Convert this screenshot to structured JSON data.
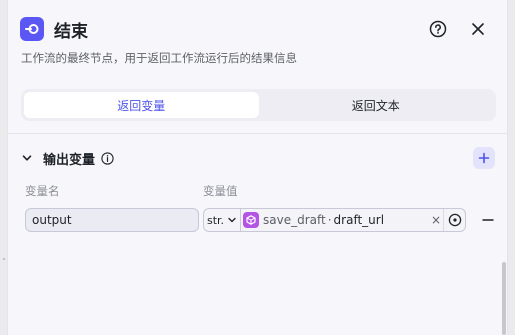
{
  "header": {
    "title": "结束",
    "icon": "end-node-icon",
    "help_icon": "question-circle-icon",
    "close_icon": "close-icon"
  },
  "description": "工作流的最终节点，用于返回工作流运行后的结果信息",
  "tabs": [
    {
      "label": "返回变量",
      "active": true
    },
    {
      "label": "返回文本",
      "active": false
    }
  ],
  "output_section": {
    "title": "输出变量",
    "columns": {
      "name": "变量名",
      "value": "变量值"
    },
    "rows": [
      {
        "name": "output",
        "type": "str.",
        "ref_node": "save_draft",
        "ref_separator": "·",
        "ref_field": "draft_url",
        "clear": "×"
      }
    ]
  },
  "colors": {
    "accent": "#4d53e8",
    "node_icon_bg": "#5b57f5",
    "ref_icon_bg": "#b454e6"
  }
}
